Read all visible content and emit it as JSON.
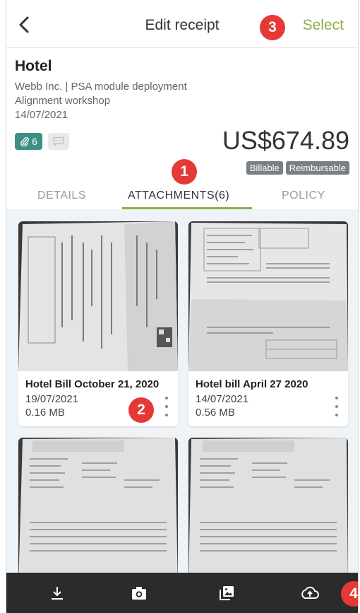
{
  "header": {
    "title": "Edit receipt",
    "select_label": "Select",
    "back_icon": "chevron-left-icon"
  },
  "markers": [
    "1",
    "2",
    "3",
    "4"
  ],
  "receipt": {
    "merchant": "Hotel",
    "company_project": "Webb Inc. | PSA module deployment",
    "task": "Alignment workshop",
    "date": "14/07/2021",
    "attachment_count": "6",
    "amount": "US$674.89",
    "tags": [
      "Billable",
      "Reimbursable"
    ]
  },
  "tabs": {
    "details": "DETAILS",
    "attachments": "ATTACHMENTS(6)",
    "policy": "POLICY",
    "active": "ATTACHMENTS(6)"
  },
  "attachments": [
    {
      "name": "Hotel Bill October 21, 2020",
      "date": "19/07/2021",
      "size": "0.16 MB"
    },
    {
      "name": "Hotel bill April 27 2020",
      "date": "14/07/2021",
      "size": "0.56 MB"
    },
    {
      "name": "",
      "date": "",
      "size": ""
    },
    {
      "name": "",
      "date": "",
      "size": ""
    }
  ],
  "toolbar": {
    "items": [
      "download-icon",
      "camera-icon",
      "gallery-icon",
      "cloud-upload-icon"
    ]
  },
  "colors": {
    "accent": "#8ab04a",
    "badge": "#3d8f85",
    "marker": "#e53935",
    "toolbar": "#2b2b2b",
    "grid_bg": "#eef3f7"
  }
}
